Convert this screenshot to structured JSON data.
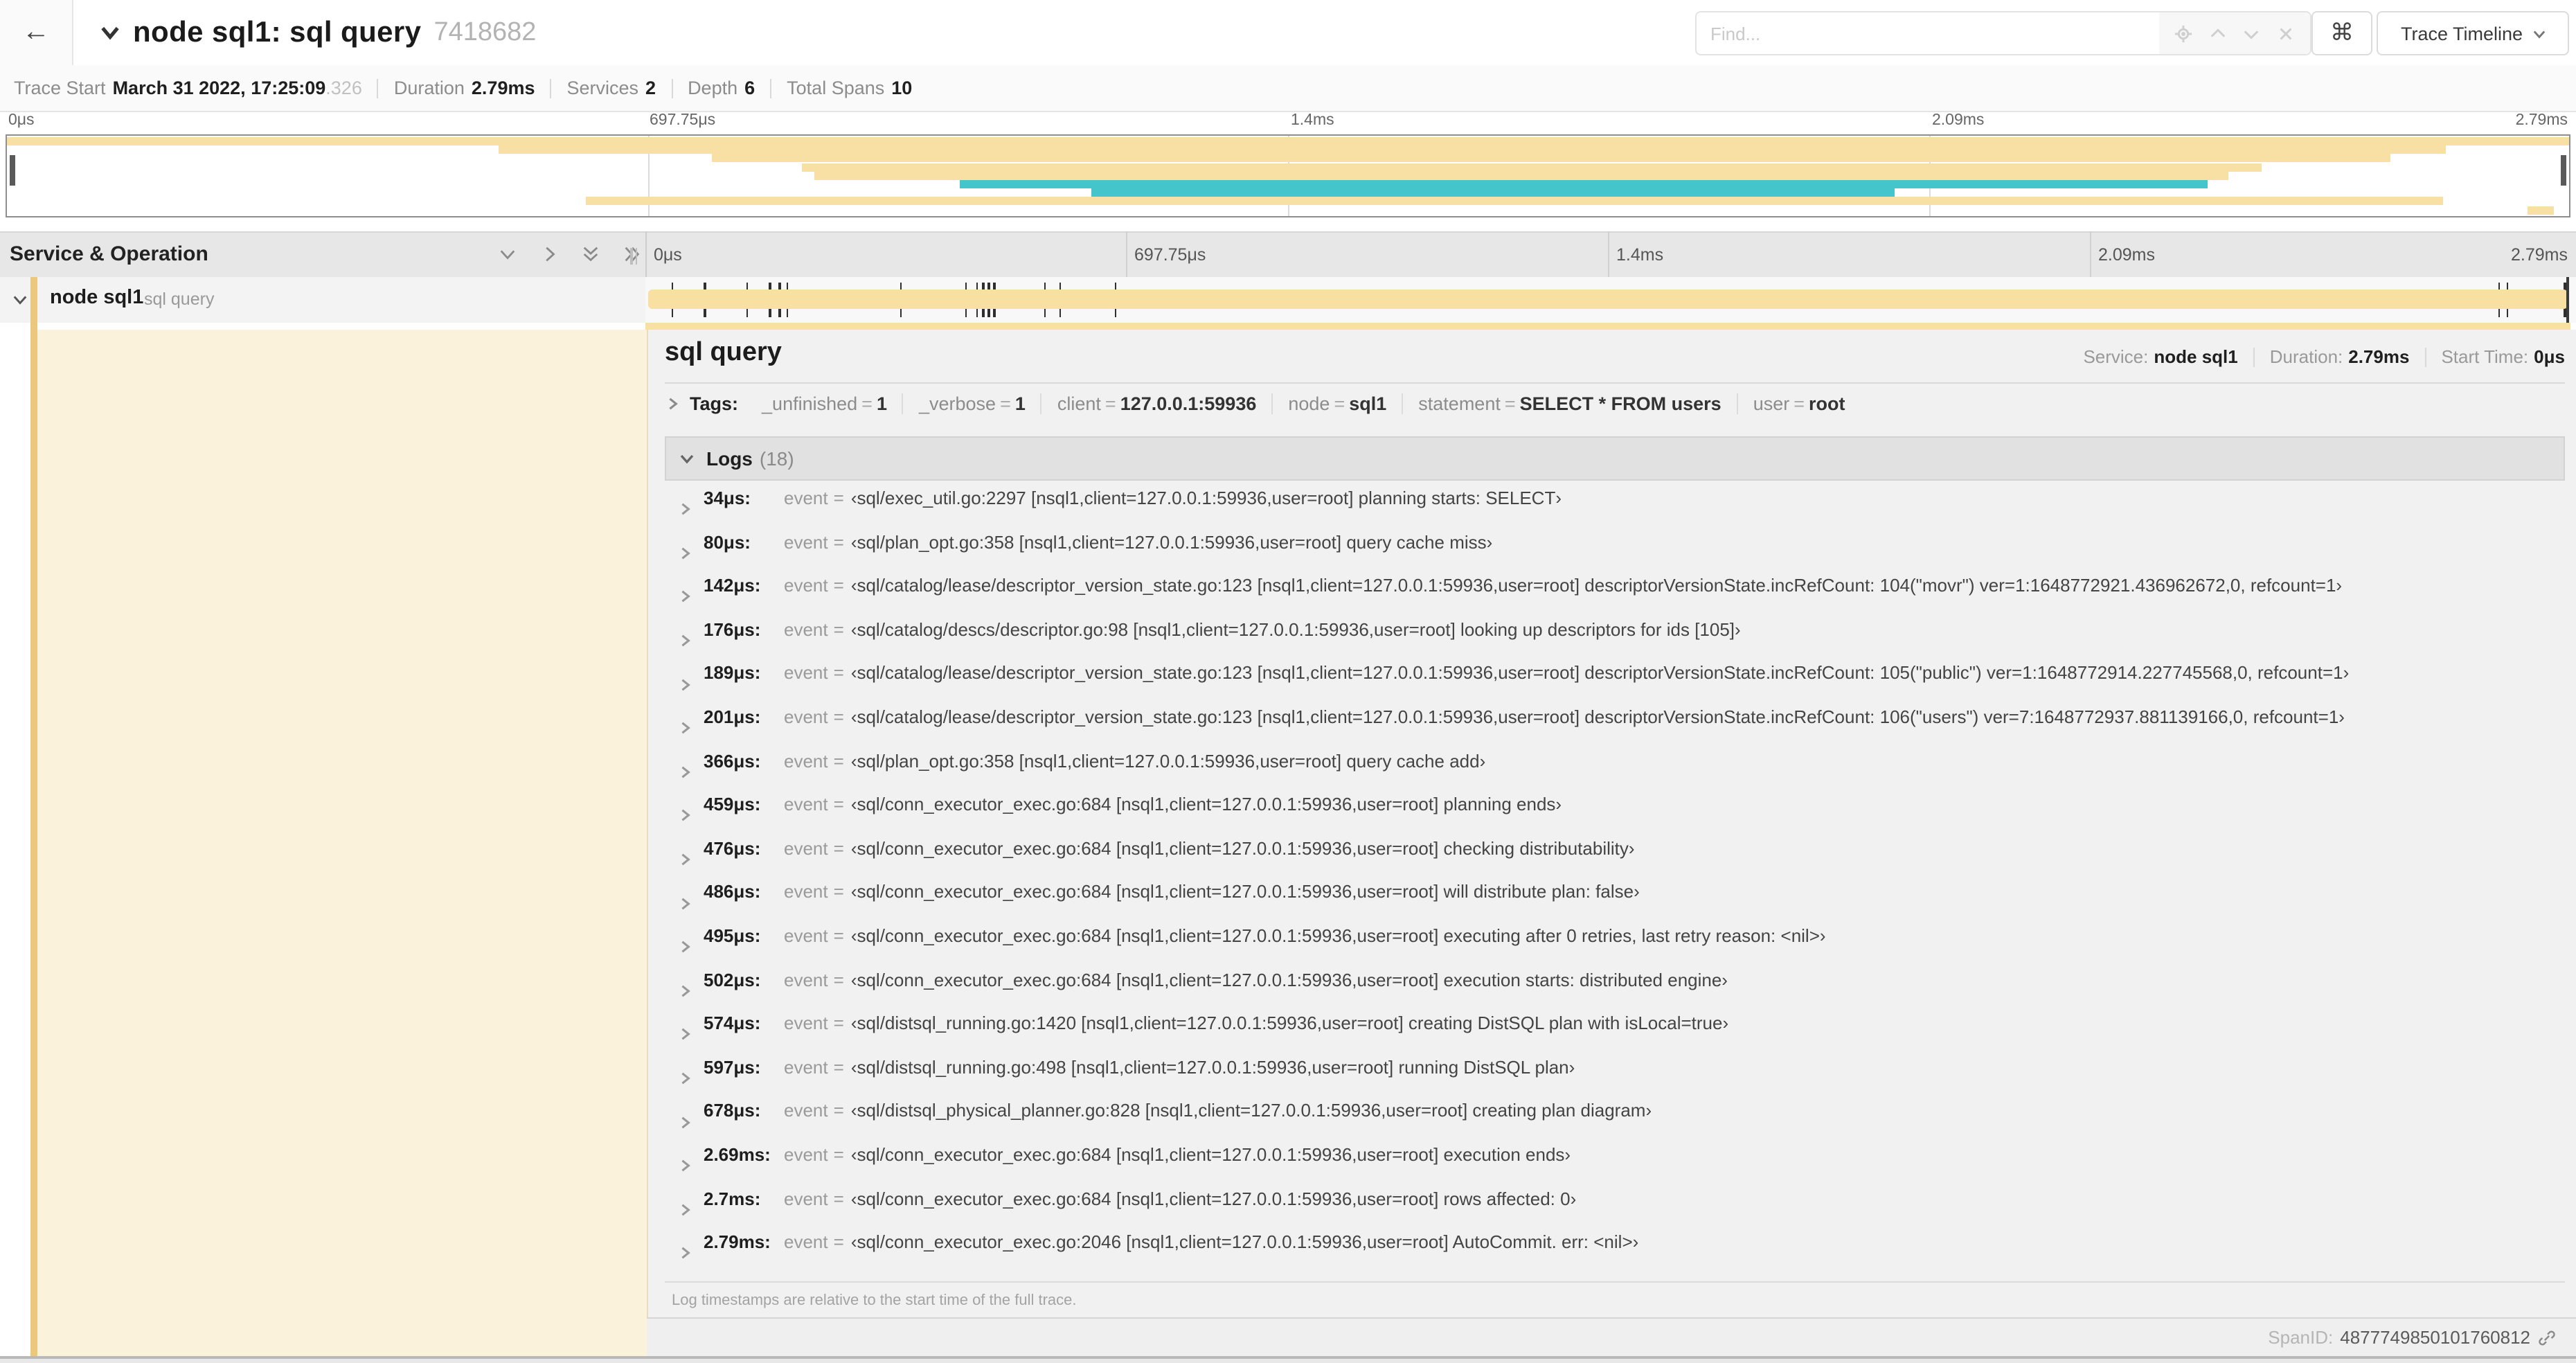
{
  "icons_note": "icons rendered as inline SVG shapes",
  "header": {
    "back_glyph": "←",
    "title": "node sql1: sql query",
    "trace_id": "7418682",
    "find_placeholder": "Find...",
    "shortcut_glyph": "⌘",
    "view_button_label": "Trace Timeline"
  },
  "trace_info": {
    "trace_start_label": "Trace Start",
    "trace_start_value": "March 31 2022, 17:25:09",
    "trace_start_fraction": ".326",
    "duration_label": "Duration",
    "duration_value": "2.79ms",
    "services_label": "Services",
    "services_value": "2",
    "depth_label": "Depth",
    "depth_value": "6",
    "total_spans_label": "Total Spans",
    "total_spans_value": "10"
  },
  "minimap": {
    "labels": [
      "0μs",
      "697.75μs",
      "1.4ms",
      "2.09ms",
      "2.79ms"
    ],
    "colors": {
      "tan": "#f8dfa4",
      "teal": "#44c5cb"
    },
    "spans": [
      {
        "l": 0,
        "w": 100,
        "c": "tan"
      },
      {
        "l": 19.2,
        "w": 76,
        "c": "tan"
      },
      {
        "l": 27.5,
        "w": 65.5,
        "c": "tan"
      },
      {
        "l": 31,
        "w": 57,
        "c": "tan"
      },
      {
        "l": 31.5,
        "w": 55.2,
        "c": "tan"
      },
      {
        "l": 37.2,
        "w": 48.7,
        "c": "teal"
      },
      {
        "l": 42.3,
        "w": 31.4,
        "c": "teal"
      },
      {
        "l": 22.6,
        "w": 72.5,
        "c": "tan"
      },
      {
        "l": 98.4,
        "w": 1,
        "c": "tan"
      }
    ]
  },
  "timeline": {
    "column_header": "Service & Operation",
    "axis_labels": [
      "0μs",
      "697.75μs",
      "1.4ms",
      "2.09ms",
      "2.79ms"
    ],
    "span": {
      "service": "node sql1",
      "operation": "sql query"
    },
    "tick_percents": [
      1.2,
      2.9,
      5.1,
      6.3,
      6.8,
      7.2,
      13.1,
      16.5,
      17.1,
      17.4,
      17.7,
      18,
      20.6,
      21.4,
      24.3,
      96.4,
      96.8,
      99.8
    ]
  },
  "detail": {
    "title": "sql query",
    "service_label": "Service:",
    "service_value": "node sql1",
    "duration_label": "Duration:",
    "duration_value": "2.79ms",
    "start_label": "Start Time:",
    "start_value": "0μs",
    "tags_label": "Tags:",
    "eq": "=",
    "tags": [
      {
        "k": "_unfinished",
        "v": "1"
      },
      {
        "k": "_verbose",
        "v": "1"
      },
      {
        "k": "client",
        "v": "127.0.0.1:59936"
      },
      {
        "k": "node",
        "v": "sql1"
      },
      {
        "k": "statement",
        "v": "SELECT * FROM users"
      },
      {
        "k": "user",
        "v": "root"
      }
    ],
    "logs_label": "Logs",
    "logs_count": "(18)",
    "log_key": "event",
    "logs": [
      {
        "t": "34μs:",
        "v": "‹sql/exec_util.go:2297 [nsql1,client=127.0.0.1:59936,user=root] planning starts: SELECT›"
      },
      {
        "t": "80μs:",
        "v": "‹sql/plan_opt.go:358 [nsql1,client=127.0.0.1:59936,user=root] query cache miss›"
      },
      {
        "t": "142μs:",
        "v": "‹sql/catalog/lease/descriptor_version_state.go:123 [nsql1,client=127.0.0.1:59936,user=root] descriptorVersionState.incRefCount: 104(\"movr\") ver=1:1648772921.436962672,0, refcount=1›"
      },
      {
        "t": "176μs:",
        "v": "‹sql/catalog/descs/descriptor.go:98 [nsql1,client=127.0.0.1:59936,user=root] looking up descriptors for ids [105]›"
      },
      {
        "t": "189μs:",
        "v": "‹sql/catalog/lease/descriptor_version_state.go:123 [nsql1,client=127.0.0.1:59936,user=root] descriptorVersionState.incRefCount: 105(\"public\") ver=1:1648772914.227745568,0, refcount=1›"
      },
      {
        "t": "201μs:",
        "v": "‹sql/catalog/lease/descriptor_version_state.go:123 [nsql1,client=127.0.0.1:59936,user=root] descriptorVersionState.incRefCount: 106(\"users\") ver=7:1648772937.881139166,0, refcount=1›"
      },
      {
        "t": "366μs:",
        "v": "‹sql/plan_opt.go:358 [nsql1,client=127.0.0.1:59936,user=root] query cache add›"
      },
      {
        "t": "459μs:",
        "v": "‹sql/conn_executor_exec.go:684 [nsql1,client=127.0.0.1:59936,user=root] planning ends›"
      },
      {
        "t": "476μs:",
        "v": "‹sql/conn_executor_exec.go:684 [nsql1,client=127.0.0.1:59936,user=root] checking distributability›"
      },
      {
        "t": "486μs:",
        "v": "‹sql/conn_executor_exec.go:684 [nsql1,client=127.0.0.1:59936,user=root] will distribute plan: false›"
      },
      {
        "t": "495μs:",
        "v": "‹sql/conn_executor_exec.go:684 [nsql1,client=127.0.0.1:59936,user=root] executing after 0 retries, last retry reason: <nil>›"
      },
      {
        "t": "502μs:",
        "v": "‹sql/conn_executor_exec.go:684 [nsql1,client=127.0.0.1:59936,user=root] execution starts: distributed engine›"
      },
      {
        "t": "574μs:",
        "v": "‹sql/distsql_running.go:1420 [nsql1,client=127.0.0.1:59936,user=root] creating DistSQL plan with isLocal=true›"
      },
      {
        "t": "597μs:",
        "v": "‹sql/distsql_running.go:498 [nsql1,client=127.0.0.1:59936,user=root] running DistSQL plan›"
      },
      {
        "t": "678μs:",
        "v": "‹sql/distsql_physical_planner.go:828 [nsql1,client=127.0.0.1:59936,user=root] creating plan diagram›"
      },
      {
        "t": "2.69ms:",
        "v": "‹sql/conn_executor_exec.go:684 [nsql1,client=127.0.0.1:59936,user=root] execution ends›"
      },
      {
        "t": "2.7ms:",
        "v": "‹sql/conn_executor_exec.go:684 [nsql1,client=127.0.0.1:59936,user=root] rows affected: 0›"
      },
      {
        "t": "2.79ms:",
        "v": "‹sql/conn_executor_exec.go:2046 [nsql1,client=127.0.0.1:59936,user=root] AutoCommit. err: <nil>›"
      }
    ],
    "footer_note": "Log timestamps are relative to the start time of the full trace.",
    "span_id_label": "SpanID:",
    "span_id_value": "4877749850101760812"
  }
}
